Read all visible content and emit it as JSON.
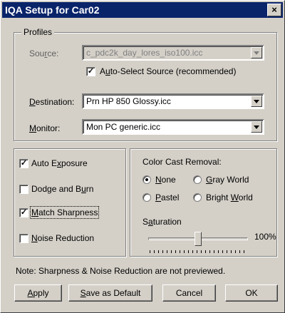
{
  "window": {
    "title": "IQA Setup for Car02",
    "close_label": "×"
  },
  "profiles": {
    "group_title": "Profiles",
    "source": {
      "label_pre": "Sou",
      "label_key": "r",
      "label_post": "ce:",
      "value": "c_pdc2k_day_lores_iso100.icc",
      "enabled": false
    },
    "auto_select": {
      "checked": true,
      "label_pre": "A",
      "label_key": "u",
      "label_post": "to-Select Source (recommended)"
    },
    "destination": {
      "label_pre": "",
      "label_key": "D",
      "label_post": "estination:",
      "value": "Prn HP 850 Glossy.icc"
    },
    "monitor": {
      "label_pre": "",
      "label_key": "M",
      "label_post": "onitor:",
      "value": "Mon PC generic.icc"
    }
  },
  "options": {
    "auto_exposure": {
      "checked": true,
      "label_pre": "Auto E",
      "label_key": "x",
      "label_post": "posure"
    },
    "dodge_burn": {
      "checked": false,
      "label_pre": "Dodge and B",
      "label_key": "u",
      "label_post": "rn"
    },
    "match_sharpness": {
      "checked": true,
      "label_pre": "",
      "label_key": "M",
      "label_post": "atch Sharpness"
    },
    "noise_reduction": {
      "checked": false,
      "label_pre": "",
      "label_key": "N",
      "label_post": "oise Reduction"
    }
  },
  "color_cast": {
    "title": "Color Cast Removal:",
    "selected": "None",
    "options": [
      {
        "pre": "",
        "key": "N",
        "post": "one"
      },
      {
        "pre": "",
        "key": "G",
        "post": "ray World"
      },
      {
        "pre": "",
        "key": "P",
        "post": "astel"
      },
      {
        "pre": "Bright ",
        "key": "W",
        "post": "orld"
      }
    ]
  },
  "saturation": {
    "label_pre": "S",
    "label_key": "a",
    "label_post": "turation",
    "value_text": "100%",
    "level": 0.5
  },
  "note": "Note: Sharpness & Noise Reduction are not previewed.",
  "buttons": {
    "apply": {
      "pre": "",
      "key": "A",
      "post": "pply"
    },
    "save_default": {
      "pre": "",
      "key": "S",
      "post": "ave as Default"
    },
    "cancel": {
      "pre": "Cancel",
      "key": "",
      "post": ""
    },
    "ok": {
      "pre": "OK",
      "key": "",
      "post": ""
    }
  }
}
